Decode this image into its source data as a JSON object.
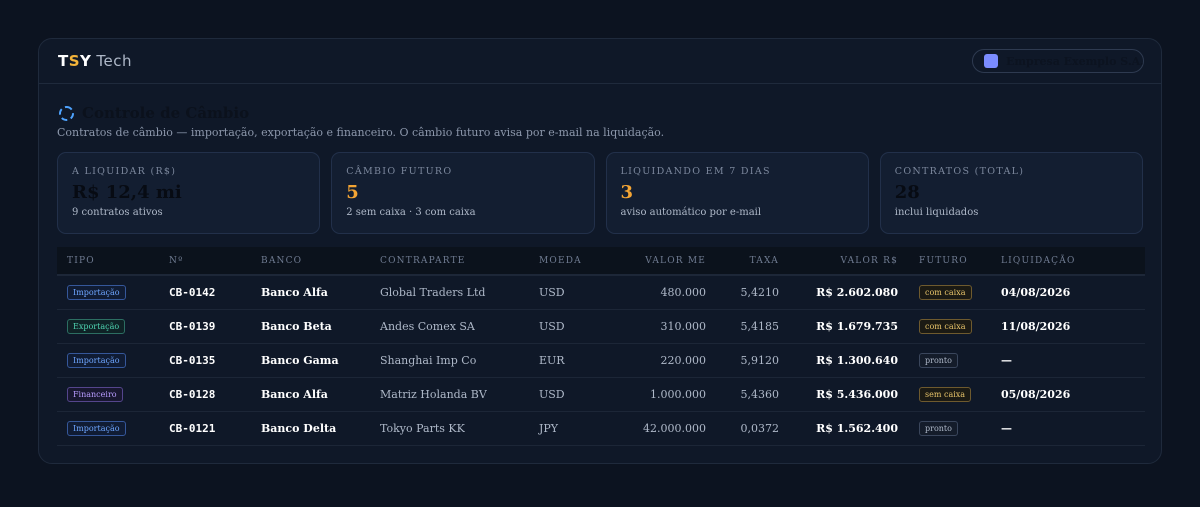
{
  "header": {
    "brand_t": "T",
    "brand_s": "S",
    "brand_y": "Y",
    "brand_tech": "Tech",
    "company": "Empresa Exemplo S.A.",
    "company_chevron": "▾",
    "company_swatch_color": "#7b8cff"
  },
  "page": {
    "icon": "exchange-icon",
    "title": "Controle de Câmbio",
    "subtitle": "Contratos de câmbio — importação, exportação e financeiro. O câmbio futuro avisa por e-mail na liquidação."
  },
  "stats": [
    {
      "label": "A LIQUIDAR (R$)",
      "value": "R$ 12,4 mi",
      "sub": "9 contratos ativos"
    },
    {
      "label": "CÂMBIO FUTURO",
      "value": "5",
      "sub": "2 sem caixa · 3 com caixa"
    },
    {
      "label": "LIQUIDANDO EM 7 DIAS",
      "value": "3",
      "sub": "aviso automático por e-mail"
    },
    {
      "label": "CONTRATOS (TOTAL)",
      "value": "28",
      "sub": "inclui liquidados"
    }
  ],
  "table": {
    "headers": [
      "TIPO",
      "Nº",
      "BANCO",
      "CONTRAPARTE",
      "MOEDA",
      "VALOR ME",
      "TAXA",
      "VALOR R$",
      "FUTURO",
      "LIQUIDAÇÃO"
    ],
    "rows": [
      {
        "tipo": "Importação",
        "num": "CB-0142",
        "banco": "Banco Alfa",
        "contraparte": "Global Traders Ltd",
        "moeda": "USD",
        "valor_me": "480.000",
        "taxa": "5,4210",
        "valor_brl": "R$ 2.602.080",
        "futuro": "com caixa",
        "liquidacao": "04/08/2026"
      },
      {
        "tipo": "Exportação",
        "num": "CB-0139",
        "banco": "Banco Beta",
        "contraparte": "Andes Comex SA",
        "moeda": "USD",
        "valor_me": "310.000",
        "taxa": "5,4185",
        "valor_brl": "R$ 1.679.735",
        "futuro": "com caixa",
        "liquidacao": "11/08/2026"
      },
      {
        "tipo": "Importação",
        "num": "CB-0135",
        "banco": "Banco Gama",
        "contraparte": "Shanghai Imp Co",
        "moeda": "EUR",
        "valor_me": "220.000",
        "taxa": "5,9120",
        "valor_brl": "R$ 1.300.640",
        "futuro": "pronto",
        "liquidacao": "—"
      },
      {
        "tipo": "Financeiro",
        "num": "CB-0128",
        "banco": "Banco Alfa",
        "contraparte": "Matriz Holanda BV",
        "moeda": "USD",
        "valor_me": "1.000.000",
        "taxa": "5,4360",
        "valor_brl": "R$ 5.436.000",
        "futuro": "sem caixa",
        "liquidacao": "05/08/2026"
      },
      {
        "tipo": "Importação",
        "num": "CB-0121",
        "banco": "Banco Delta",
        "contraparte": "Tokyo Parts KK",
        "moeda": "JPY",
        "valor_me": "42.000.000",
        "taxa": "0,0372",
        "valor_brl": "R$ 1.562.400",
        "futuro": "pronto",
        "liquidacao": "—"
      }
    ]
  },
  "colors": {
    "background": "#0c1320",
    "accent_orange": "#f4a534",
    "tag_importacao": "#6ea6ff",
    "tag_exportacao": "#4ed3b0",
    "tag_financeiro": "#b89cff",
    "futuro_caixa": "#e8c46a"
  }
}
